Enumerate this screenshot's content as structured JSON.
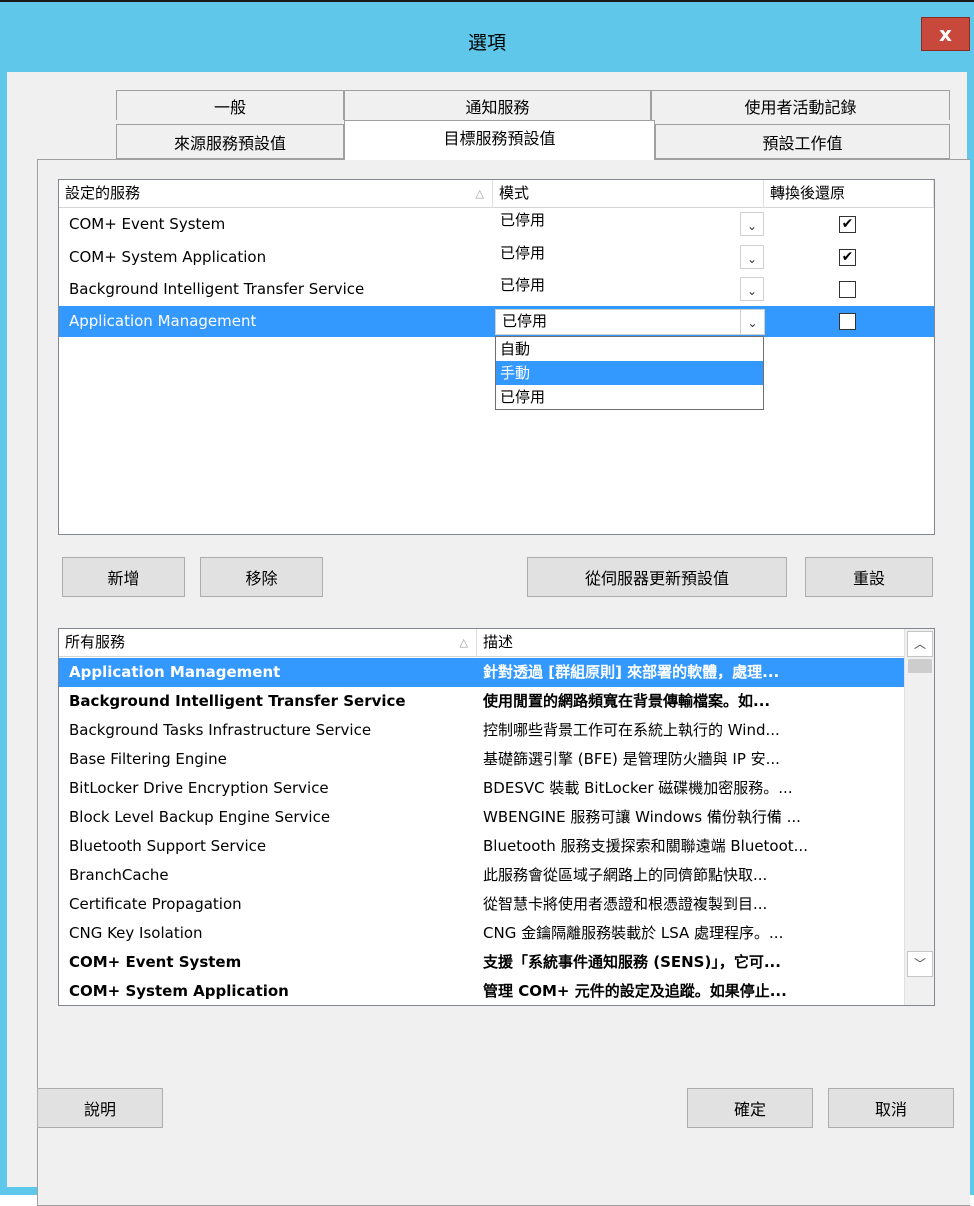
{
  "window": {
    "title": "選項",
    "close_label": "x"
  },
  "tabs": {
    "row1": [
      "一般",
      "通知服務",
      "使用者活動記錄"
    ],
    "row2": [
      "來源服務預設值",
      "目標服務預設值",
      "預設工作值"
    ],
    "active": "目標服務預設值"
  },
  "configured": {
    "columns": [
      "設定的服務",
      "模式",
      "轉換後還原"
    ],
    "rows": [
      {
        "service": "COM+ Event System",
        "mode": "已停用",
        "restore": true
      },
      {
        "service": "COM+ System Application",
        "mode": "已停用",
        "restore": true
      },
      {
        "service": "Background Intelligent Transfer Service",
        "mode": "已停用",
        "restore": false
      },
      {
        "service": "Application Management",
        "mode": "已停用",
        "restore": false,
        "selected": true
      }
    ],
    "dropdown_options": [
      "自動",
      "手動",
      "已停用"
    ],
    "dropdown_highlighted": "手動"
  },
  "buttons": {
    "add": "新增",
    "remove": "移除",
    "update_from_server": "從伺服器更新預設值",
    "reset": "重設",
    "help": "說明",
    "ok": "確定",
    "cancel": "取消"
  },
  "all_services": {
    "columns": [
      "所有服務",
      "描述"
    ],
    "rows": [
      {
        "name": "Application Management",
        "desc": "針對透過 [群組原則] 來部署的軟體，處理...",
        "bold": true,
        "selected": true
      },
      {
        "name": "Background Intelligent Transfer Service",
        "desc": "使用閒置的網路頻寬在背景傳輸檔案。如...",
        "bold": true
      },
      {
        "name": "Background Tasks Infrastructure Service",
        "desc": "控制哪些背景工作可在系統上執行的 Wind..."
      },
      {
        "name": "Base Filtering Engine",
        "desc": "基礎篩選引擎 (BFE) 是管理防火牆與 IP 安..."
      },
      {
        "name": "BitLocker Drive Encryption Service",
        "desc": "BDESVC 裝載 BitLocker 磁碟機加密服務。..."
      },
      {
        "name": "Block Level Backup Engine Service",
        "desc": "WBENGINE 服務可讓 Windows 備份執行備 ..."
      },
      {
        "name": "Bluetooth Support Service",
        "desc": "Bluetooth 服務支援探索和關聯遠端 Bluetoot..."
      },
      {
        "name": "BranchCache",
        "desc": "此服務會從區域子網路上的同儕節點快取..."
      },
      {
        "name": "Certificate Propagation",
        "desc": "從智慧卡將使用者憑證和根憑證複製到目..."
      },
      {
        "name": "CNG Key Isolation",
        "desc": "CNG 金鑰隔離服務裝載於 LSA 處理程序。..."
      },
      {
        "name": "COM+ Event System",
        "desc": "支援「系統事件通知服務 (SENS)」，它可...",
        "bold": true
      },
      {
        "name": "COM+ System Application",
        "desc": "管理 COM+ 元件的設定及追蹤。如果停止...",
        "bold": true
      }
    ]
  },
  "icons": {
    "close": "close-icon",
    "check": "checkmark-icon",
    "combo": "chevron-down-icon",
    "scroll_up": "chevron-up-icon",
    "scroll_down": "chevron-down-icon"
  },
  "colors": {
    "title_bar": "#5ec7ea",
    "selection": "#3399ff",
    "close_button": "#c9483c"
  }
}
